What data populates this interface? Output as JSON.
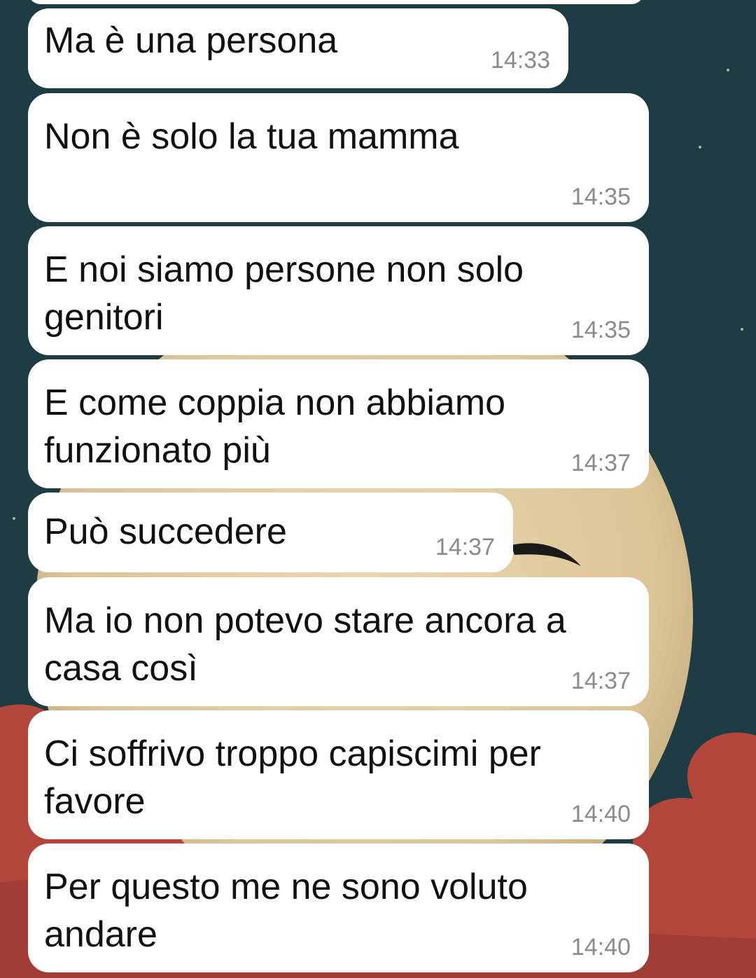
{
  "theme": {
    "wallpaper_sky": "#1d3c43",
    "wallpaper_moon": "#e3cfa4",
    "wallpaper_clouds": "#b3453b",
    "bubble_bg": "#ffffff",
    "text_color": "#111111",
    "time_color": "#8b8b8b"
  },
  "chat": {
    "messages": [
      {
        "text": "Ma è una persona",
        "time": "14:33"
      },
      {
        "text": "Non è solo la tua mamma",
        "time": "14:35"
      },
      {
        "text": "E noi siamo persone non solo\ngenitori",
        "time": "14:35"
      },
      {
        "text": "E come coppia non abbiamo\nfunzionato più",
        "time": "14:37"
      },
      {
        "text": "Può succedere",
        "time": "14:37"
      },
      {
        "text": "Ma io non potevo stare ancora a\ncasa così",
        "time": "14:37"
      },
      {
        "text": "Ci soffrivo troppo capiscimi per\nfavore",
        "time": "14:40"
      },
      {
        "text": "Per questo me ne sono voluto\nandare",
        "time": "14:40"
      }
    ]
  }
}
